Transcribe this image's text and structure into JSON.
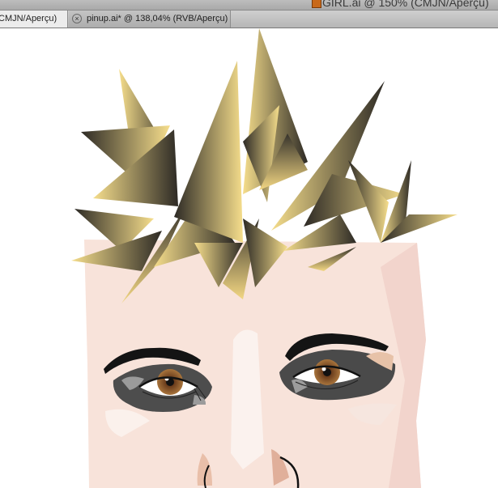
{
  "window": {
    "title": "GIRL.ai @ 150% (CMJN/Aperçu)"
  },
  "tabs": [
    {
      "label": "CMJN/Aperçu)",
      "active": true
    },
    {
      "label": "pinup.ai* @ 138,04% (RVB/Aperçu)",
      "active": false
    }
  ],
  "artwork": {
    "description_icons": [
      "hair-spikes-illustration",
      "face-illustration",
      "eye-illustration"
    ],
    "colors": {
      "skin": "#f8e3da",
      "hair_light": "#f6de8c",
      "hair_dark": "#2d2a25",
      "iris": "#7a4a26",
      "shadow": "#4a4a4a"
    }
  }
}
